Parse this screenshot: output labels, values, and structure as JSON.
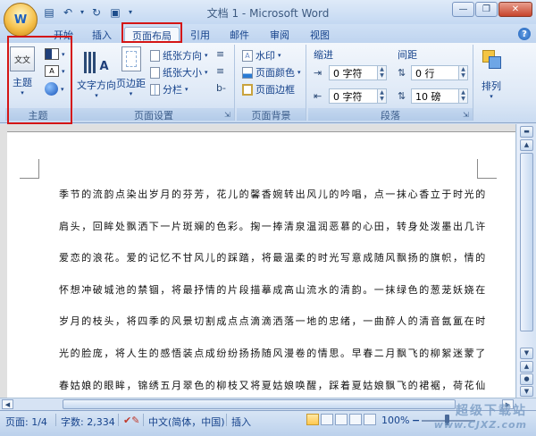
{
  "window": {
    "title": "文档 1 - Microsoft Word"
  },
  "office_button": {
    "letter": "W"
  },
  "tabs": [
    {
      "label": "开始"
    },
    {
      "label": "插入"
    },
    {
      "label": "页面布局"
    },
    {
      "label": "引用"
    },
    {
      "label": "邮件"
    },
    {
      "label": "审阅"
    },
    {
      "label": "视图"
    }
  ],
  "active_tab": "页面布局",
  "groups": {
    "themes": {
      "label": "主题",
      "theme_button": "主题",
      "theme_icon_text": "文文"
    },
    "page_setup": {
      "label": "页面设置",
      "text_direction": "文字方向",
      "margins": "页边距",
      "orientation": "纸张方向",
      "size": "纸张大小",
      "columns": "分栏"
    },
    "page_background": {
      "label": "页面背景",
      "watermark": "水印",
      "page_color": "页面颜色",
      "page_borders": "页面边框"
    },
    "paragraph": {
      "label": "段落",
      "indent_title": "缩进",
      "spacing_title": "间距",
      "indent_left": "0 字符",
      "indent_right": "0 字符",
      "spacing_before": "0 行",
      "spacing_after": "10 磅"
    },
    "arrange": {
      "label": "排列"
    }
  },
  "document": {
    "lines": [
      "季节的流韵点染出岁月的芬芳，花儿的馨香婉转出风儿的吟唱，点一抹心香立于时光的",
      "肩头，回眸处飘洒下一片斑斓的色彩。掬一捧清泉温润恶慕的心田，转身处泼墨出几许",
      "爱恋的浪花。爱的记忆不甘风儿的踩踏，将最温柔的时光写意成随风飘扬的旗帜，情的",
      "怀想冲破城池的禁锢，将最抒情的片段描摹成高山流水的清韵。一抹绿色的葱茏妖娆在",
      "岁月的枝头，将四季的风景切割成点点滴滴洒落一地的忠绪，一曲醉人的清音氤氲在时",
      "光的脸庞，将人生的感悟装点成纷纷扬扬随风漫卷的情思。早春二月飘飞的柳絮迷蒙了",
      "春姑娘的眼眸，锦绣五月翠色的柳枝又将夏姑娘唤醒，踩着夏姑娘飘飞的裙裾，荷花仙"
    ]
  },
  "status": {
    "page": "页面: 1/4",
    "words": "字数: 2,334",
    "language": "中文(简体，中国)",
    "mode": "插入",
    "zoom": "100%"
  },
  "watermark": {
    "line1": "超级下载站",
    "line2": "www.CJXZ.com"
  },
  "highlight_color": "#d41515"
}
